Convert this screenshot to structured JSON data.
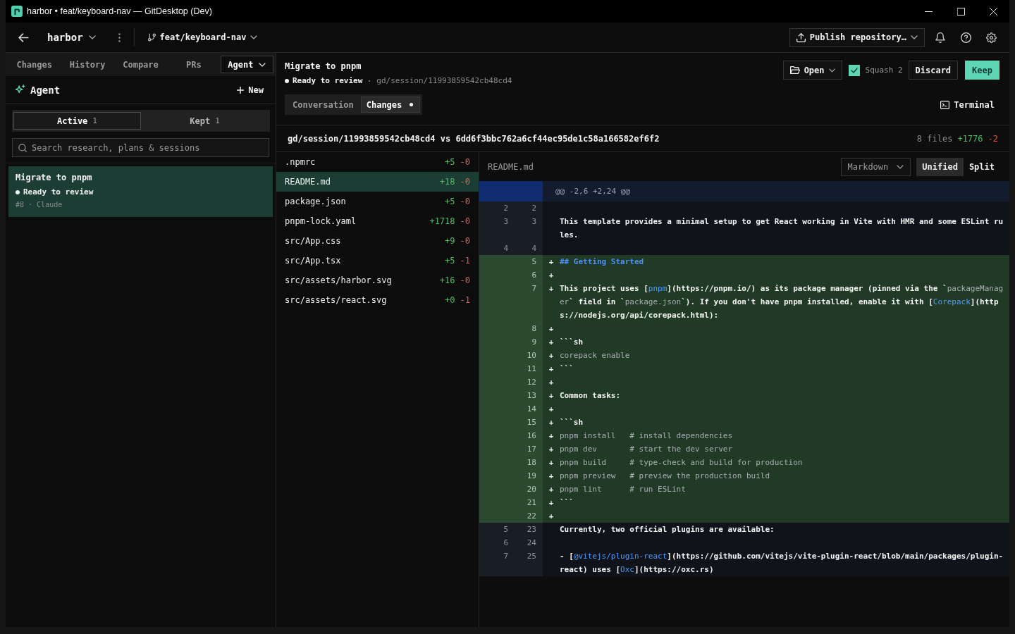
{
  "window": {
    "title": "harbor • feat/keyboard-nav — GitDesktop (Dev)"
  },
  "toolbar": {
    "repository": "harbor",
    "branch": "feat/keyboard-nav",
    "publish": "Publish repository…"
  },
  "sidebar": {
    "tabs": [
      {
        "label": "Changes",
        "selected": false,
        "kind": "tab"
      },
      {
        "label": "History",
        "selected": false,
        "kind": "tab"
      },
      {
        "label": "Compare",
        "selected": false,
        "kind": "tab"
      },
      {
        "label": "PRs",
        "selected": false,
        "kind": "tab"
      },
      {
        "label": "Agent",
        "selected": true,
        "kind": "dropdown"
      }
    ],
    "title": "Agent",
    "new_button": "New",
    "filters": [
      {
        "label": "Active",
        "count": "1",
        "selected": true
      },
      {
        "label": "Kept",
        "count": "1",
        "selected": false
      }
    ],
    "search": {
      "placeholder": "Search research, plans & sessions"
    },
    "sessions": [
      {
        "title": "Migrate to pnpm",
        "status": "Ready to review",
        "meta": "#8 · Claude",
        "selected": true
      }
    ]
  },
  "session": {
    "title": "Migrate to pnpm",
    "status": "Ready to review",
    "ref": "gd/session/11993859542cb48cd4",
    "open_button": "Open",
    "squash": {
      "label": "Squash 2",
      "checked": true
    },
    "discard_button": "Discard",
    "keep_button": "Keep",
    "views": [
      {
        "label": "Conversation",
        "selected": false,
        "dot": false
      },
      {
        "label": "Changes",
        "selected": true,
        "dot": true
      }
    ],
    "terminal_button": "Terminal"
  },
  "comparison": {
    "refs": "gd/session/11993859542cb48cd4 vs 6dd6f3bbc762a6cf44ec95de1c58a166582ef6f2",
    "files": "8 files",
    "added": "+1776",
    "removed": "-2"
  },
  "files": [
    {
      "name": ".npmrc",
      "added": "+5",
      "removed": "-0",
      "selected": false
    },
    {
      "name": "README.md",
      "added": "+18",
      "removed": "-0",
      "selected": true
    },
    {
      "name": "package.json",
      "added": "+5",
      "removed": "-0",
      "selected": false
    },
    {
      "name": "pnpm-lock.yaml",
      "added": "+1718",
      "removed": "-0",
      "selected": false
    },
    {
      "name": "src/App.css",
      "added": "+9",
      "removed": "-0",
      "selected": false
    },
    {
      "name": "src/App.tsx",
      "added": "+5",
      "removed": "-1",
      "selected": false
    },
    {
      "name": "src/assets/harbor.svg",
      "added": "+16",
      "removed": "-0",
      "selected": false
    },
    {
      "name": "src/assets/react.svg",
      "added": "+0",
      "removed": "-1",
      "selected": false
    }
  ],
  "diff": {
    "file": "README.md",
    "format": "Markdown",
    "modes": [
      {
        "label": "Unified",
        "selected": true
      },
      {
        "label": "Split",
        "selected": false
      }
    ],
    "lines": [
      {
        "kind": "hunk",
        "segments": [
          {
            "kind": "plain",
            "text": "@@ -2,6 +2,24 @@"
          }
        ]
      },
      {
        "kind": "context",
        "old": "2",
        "new": "2"
      },
      {
        "kind": "context",
        "old": "3",
        "new": "3",
        "segments": [
          {
            "kind": "plain",
            "text": "This template provides a minimal setup to get React working in Vite with HMR and some ESLint rules."
          }
        ]
      },
      {
        "kind": "context",
        "old": "4",
        "new": "4"
      },
      {
        "kind": "added",
        "new": "5",
        "marker": "+",
        "segments": [
          {
            "kind": "heading",
            "text": "## Getting Started"
          }
        ]
      },
      {
        "kind": "added",
        "new": "6",
        "marker": "+"
      },
      {
        "kind": "added",
        "new": "7",
        "marker": "+",
        "segments": [
          {
            "kind": "plain",
            "text": "This project uses ["
          },
          {
            "kind": "link",
            "text": "pnpm"
          },
          {
            "kind": "plain",
            "text": "](https://pnpm.io/) as its package manager (pinned via the `"
          },
          {
            "kind": "code",
            "text": "packageManager"
          },
          {
            "kind": "plain",
            "text": "` field in `"
          },
          {
            "kind": "code",
            "text": "package.json"
          },
          {
            "kind": "plain",
            "text": "`). If you don't have pnpm installed, enable it with ["
          },
          {
            "kind": "link",
            "text": "Corepack"
          },
          {
            "kind": "plain",
            "text": "](https://nodejs.org/api/corepack.html):"
          }
        ]
      },
      {
        "kind": "added",
        "new": "8",
        "marker": "+"
      },
      {
        "kind": "added",
        "new": "9",
        "marker": "+",
        "segments": [
          {
            "kind": "plain",
            "text": "```sh"
          }
        ]
      },
      {
        "kind": "added",
        "new": "10",
        "marker": "+",
        "segments": [
          {
            "kind": "code",
            "text": "corepack enable"
          }
        ]
      },
      {
        "kind": "added",
        "new": "11",
        "marker": "+",
        "segments": [
          {
            "kind": "plain",
            "text": "```"
          }
        ]
      },
      {
        "kind": "added",
        "new": "12",
        "marker": "+"
      },
      {
        "kind": "added",
        "new": "13",
        "marker": "+",
        "segments": [
          {
            "kind": "plain",
            "text": "Common tasks:"
          }
        ]
      },
      {
        "kind": "added",
        "new": "14",
        "marker": "+"
      },
      {
        "kind": "added",
        "new": "15",
        "marker": "+",
        "segments": [
          {
            "kind": "plain",
            "text": "```sh"
          }
        ]
      },
      {
        "kind": "added",
        "new": "16",
        "marker": "+",
        "segments": [
          {
            "kind": "code",
            "text": "pnpm install   # install dependencies"
          }
        ]
      },
      {
        "kind": "added",
        "new": "17",
        "marker": "+",
        "segments": [
          {
            "kind": "code",
            "text": "pnpm dev       # start the dev server"
          }
        ]
      },
      {
        "kind": "added",
        "new": "18",
        "marker": "+",
        "segments": [
          {
            "kind": "code",
            "text": "pnpm build     # type-check and build for production"
          }
        ]
      },
      {
        "kind": "added",
        "new": "19",
        "marker": "+",
        "segments": [
          {
            "kind": "code",
            "text": "pnpm preview   # preview the production build"
          }
        ]
      },
      {
        "kind": "added",
        "new": "20",
        "marker": "+",
        "segments": [
          {
            "kind": "code",
            "text": "pnpm lint      # run ESLint"
          }
        ]
      },
      {
        "kind": "added",
        "new": "21",
        "marker": "+",
        "segments": [
          {
            "kind": "plain",
            "text": "```"
          }
        ]
      },
      {
        "kind": "added",
        "new": "22",
        "marker": "+"
      },
      {
        "kind": "context",
        "old": "5",
        "new": "23",
        "segments": [
          {
            "kind": "plain",
            "text": "Currently, two official plugins are available:"
          }
        ]
      },
      {
        "kind": "context",
        "old": "6",
        "new": "24"
      },
      {
        "kind": "context",
        "old": "7",
        "new": "25",
        "segments": [
          {
            "kind": "plain",
            "text": "- ["
          },
          {
            "kind": "link",
            "text": "@vitejs/plugin-react"
          },
          {
            "kind": "plain",
            "text": "](https://github.com/vitejs/vite-plugin-react/blob/main/packages/plugin-react) uses ["
          },
          {
            "kind": "link",
            "text": "Oxc"
          },
          {
            "kind": "plain",
            "text": "](https://oxc.rs)"
          }
        ]
      }
    ]
  }
}
